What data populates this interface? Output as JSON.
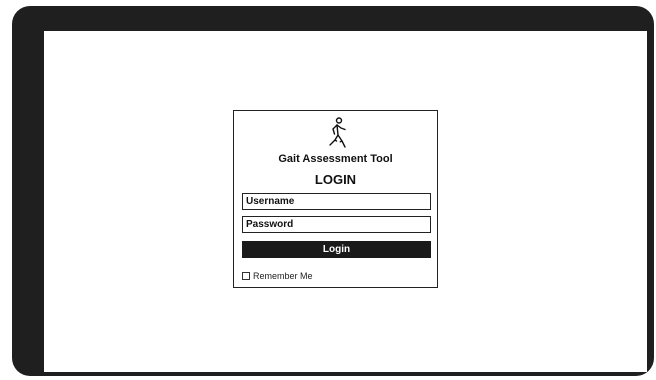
{
  "app": {
    "title": "Gait Assessment Tool",
    "logo_icon": "walking-person-icon"
  },
  "login_form": {
    "heading": "LOGIN",
    "username_placeholder": "Username",
    "password_placeholder": "Password",
    "submit_label": "Login",
    "remember_label": "Remember Me",
    "remember_checked": false
  },
  "colors": {
    "frame": "#1f1f1f",
    "button_bg": "#1a1a1a",
    "button_text": "#ffffff"
  }
}
